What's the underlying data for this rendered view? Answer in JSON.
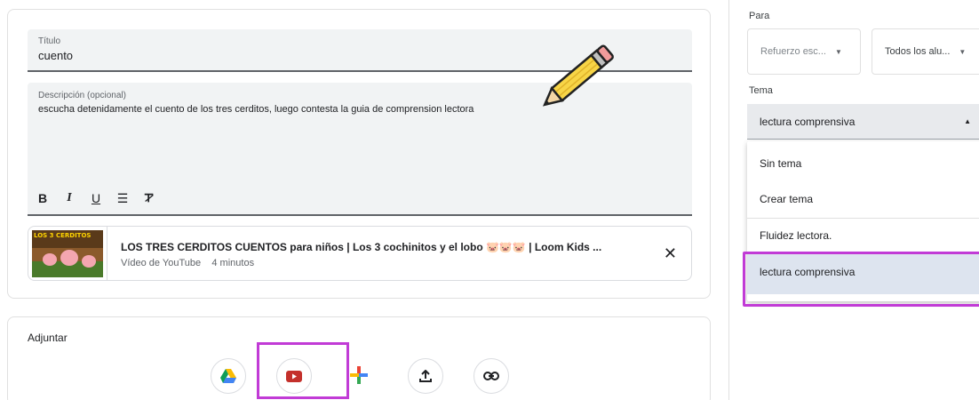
{
  "form": {
    "title_label": "Título",
    "title_value": "cuento",
    "description_label": "Descripción (opcional)",
    "description_value": "escucha detenidamente el cuento de los tres cerditos, luego contesta la guia de comprension lectora",
    "toolbar": {
      "bold": "B",
      "italic": "I",
      "underline": "U",
      "list": "☰",
      "clear_format": "T̶"
    }
  },
  "attachment": {
    "thumbnail_text": "LOS 3 CERDITOS",
    "title": "LOS TRES CERDITOS CUENTOS para niños | Los 3 cochinitos y el lobo 🐷🐷🐷 | Loom Kids ...",
    "source": "Vídeo de YouTube",
    "duration": "4 minutos",
    "remove_icon": "close-icon"
  },
  "attach_section": {
    "label": "Adjuntar",
    "buttons": [
      "drive-icon",
      "youtube-icon",
      "create-icon",
      "upload-icon",
      "link-icon"
    ]
  },
  "sidebar": {
    "para_label": "Para",
    "class_select": "Refuerzo esc...",
    "students_select": "Todos los alu...",
    "tema_label": "Tema",
    "tema_value": "lectura comprensiva",
    "options": [
      "Sin tema",
      "Crear tema",
      "Fluidez lectora.",
      "lectura comprensiva"
    ],
    "selected_option": "lectura comprensiva"
  },
  "colors": {
    "highlight": "#c13bd6",
    "youtube_red": "#c4302b",
    "selected_bg": "#dde4ef"
  }
}
